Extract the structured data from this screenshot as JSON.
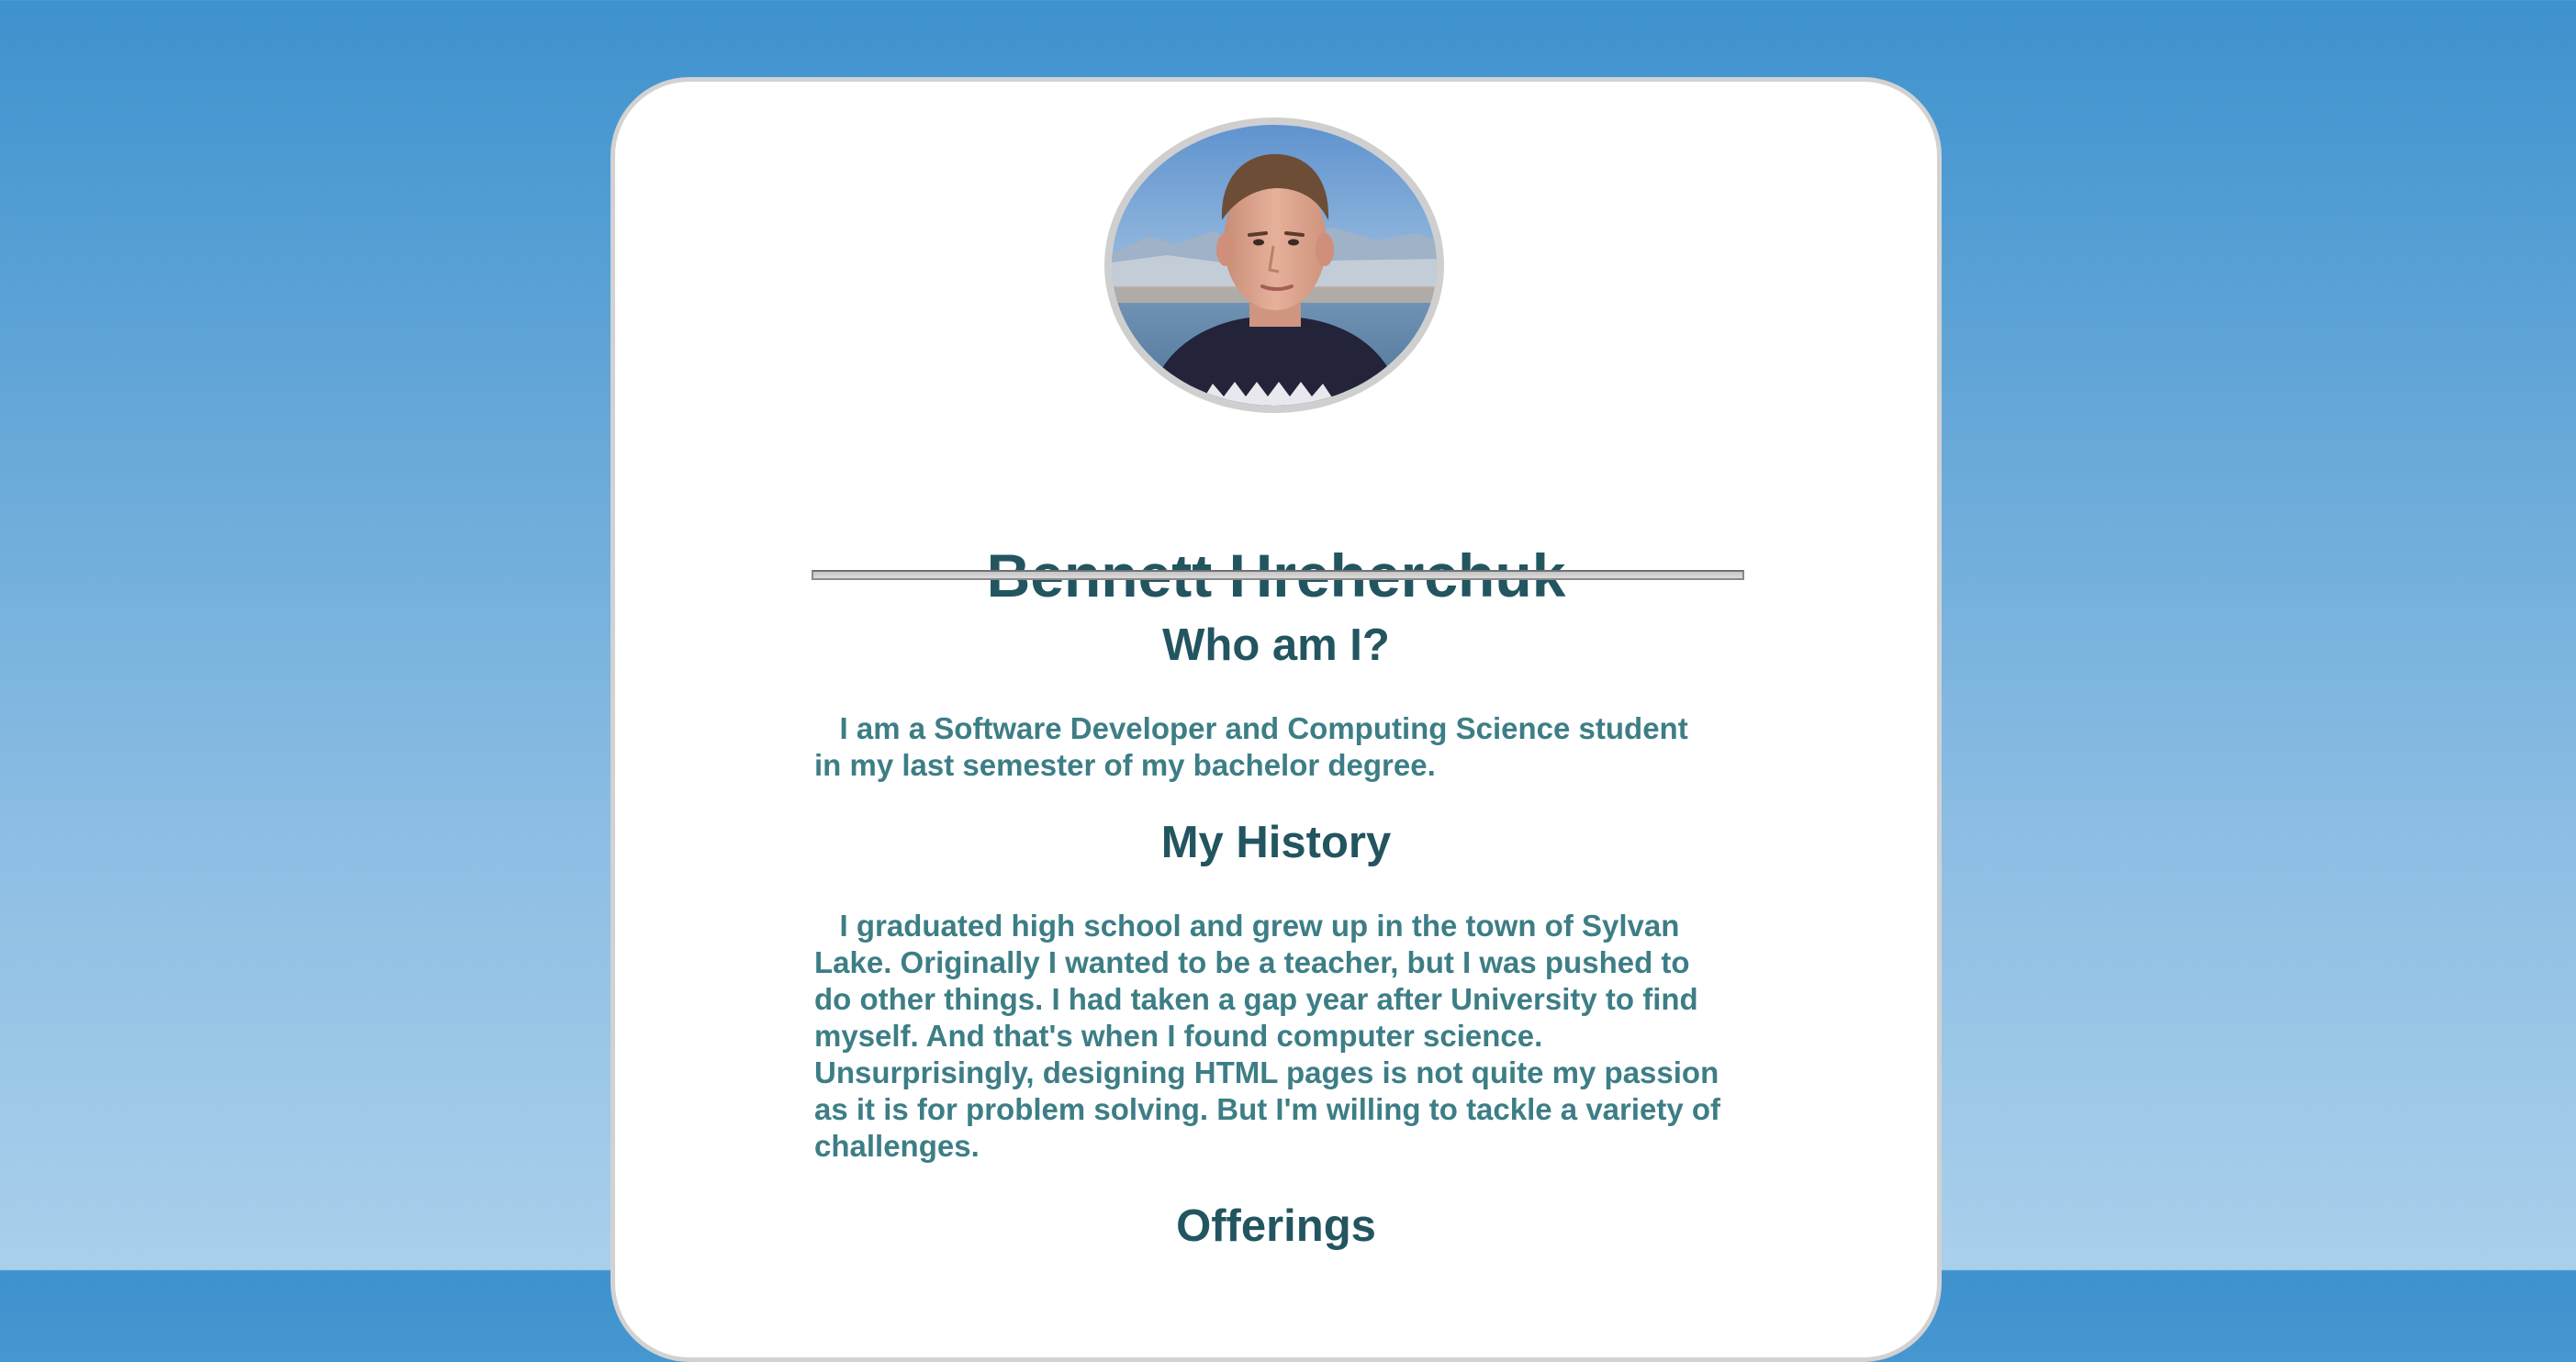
{
  "profile": {
    "name": "Bennett Hreherchuk"
  },
  "sections": {
    "who": {
      "title": "Who am I?",
      "lines": [
        "   I am a Software Developer and Computing Science student",
        "in my last semester of my bachelor degree."
      ]
    },
    "history": {
      "title": "My History",
      "lines": [
        "   I graduated high school and grew up in the town of Sylvan",
        "Lake. Originally I wanted to be a teacher, but I was pushed to",
        "do other things. I had taken a gap year after University to find",
        "myself. And that's when I found computer science.",
        "Unsurprisingly, designing HTML pages is not quite my passion",
        "as it is for problem solving. But I'm willing to tackle a variety of",
        "challenges."
      ]
    },
    "offerings": {
      "title": "Offerings"
    }
  },
  "colors": {
    "heading": "#225560",
    "body_text": "#3d7e86",
    "background_top": "#3e92ce",
    "background_bottom": "#a9d0ec"
  }
}
